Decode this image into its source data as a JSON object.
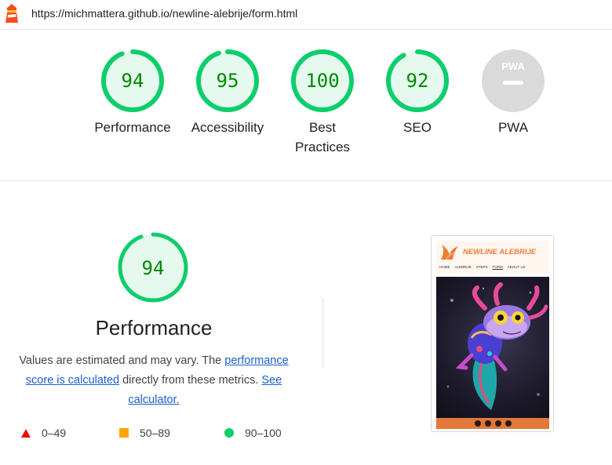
{
  "browser": {
    "url": "https://michmattera.github.io/newline-alebrije/form.html",
    "logo_icon": "lighthouse-icon"
  },
  "scores": [
    {
      "label": "Performance",
      "score": "94",
      "value": 94
    },
    {
      "label": "Accessibility",
      "score": "95",
      "value": 95
    },
    {
      "label": "Best Practices",
      "score": "100",
      "value": 100
    },
    {
      "label": "SEO",
      "score": "92",
      "value": 92
    },
    {
      "label": "PWA",
      "score": "PWA",
      "value": null
    }
  ],
  "colors": {
    "pass": "#0cce6b",
    "pass_text": "#008800",
    "pass_bg": "#e6f9ee",
    "average": "#ffa400",
    "fail": "#eb0f00",
    "neutral": "#dadada",
    "link": "#1a5fcf"
  },
  "performance": {
    "score": "94",
    "value": 94,
    "title": "Performance",
    "desc_text1": "Values are estimated and may vary. The ",
    "desc_link1": "performance score is calculated",
    "desc_text2": " directly from these metrics. ",
    "desc_link2": "See calculator."
  },
  "legend": [
    {
      "label": "0–49",
      "icon": "triangle-icon"
    },
    {
      "label": "50–89",
      "icon": "square-icon"
    },
    {
      "label": "90–100",
      "icon": "circle-icon"
    }
  ],
  "screenshot": {
    "brand": "NEWLINE ALEBRIJE",
    "nav": [
      "HOME",
      "ALEBRIJE",
      "STEPS",
      "FORM",
      "ABOUT US"
    ],
    "footer_icons": [
      "instagram-icon",
      "facebook-icon",
      "youtube-icon",
      "github-icon"
    ]
  }
}
